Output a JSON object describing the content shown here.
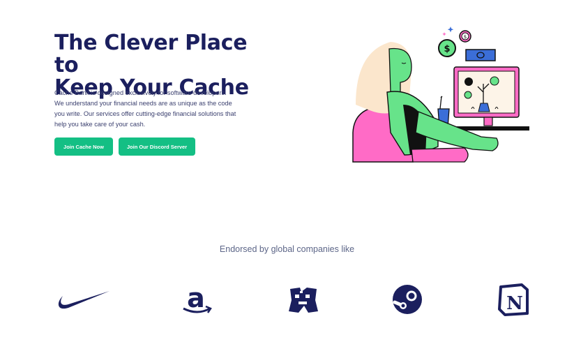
{
  "hero": {
    "title_line1": "The Clever Place to",
    "title_line2": "Keep Your Cache",
    "description": "Cache Bank is designed exclusively for software developers. We understand your financial needs are as unique as the code you write. Our services offer cutting-edge financial solutions that help you take care of your cash.",
    "primary_button": "Join Cache Now",
    "secondary_button": "Join Our Discord Server"
  },
  "endorsements": {
    "heading": "Endorsed by global companies like",
    "logos": [
      "nike-logo",
      "amazon-logo",
      "minecraft-logo",
      "steam-logo",
      "notion-logo"
    ],
    "notion_letter": "N"
  },
  "colors": {
    "navy": "#1b1f5e",
    "accent_green": "#14bf84",
    "pink": "#ff6bc6",
    "character_green": "#67e38a"
  }
}
